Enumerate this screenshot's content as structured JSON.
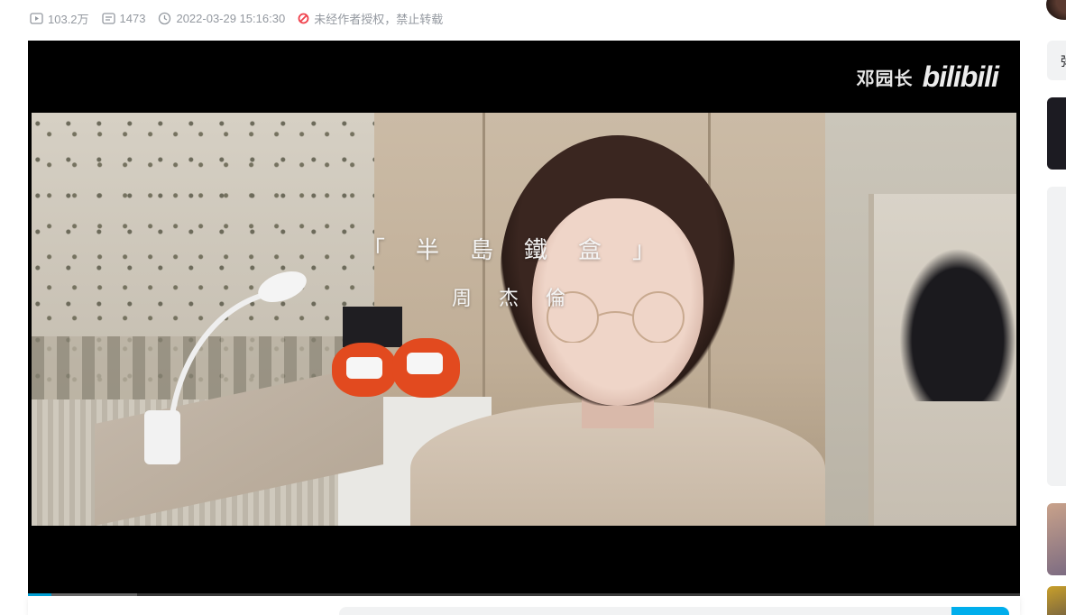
{
  "video_meta": {
    "views": "103.2万",
    "danmaku_count": "1473",
    "publish_time": "2022-03-29 15:16:30",
    "copyright_notice": "未经作者授权，禁止转载"
  },
  "icons": {
    "views": "play-count-icon",
    "danmaku": "danmaku-icon",
    "time": "clock-icon",
    "copyright": "no-reprint-icon"
  },
  "player": {
    "watermark_name": "邓园长",
    "watermark_logo": "bilibili",
    "lyric_title": "「半島鐵盒」",
    "lyric_artist": "周杰倫",
    "progress_played": 0.024,
    "progress_buffered": 0.11
  },
  "right_column": {
    "partial_label": "弹"
  },
  "colors": {
    "accent": "#00aeec",
    "warning": "#f0414c",
    "meta_text": "#9499a0"
  }
}
